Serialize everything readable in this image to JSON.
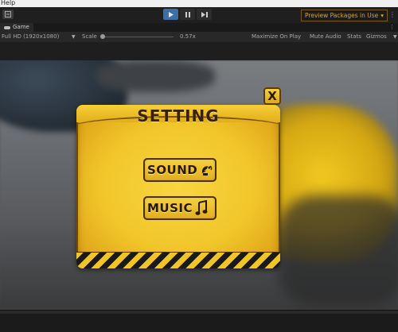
{
  "menubar": {
    "help_label": "Help"
  },
  "toolbar": {
    "preview_label": "Preview Packages in Use",
    "more_label": "⋮"
  },
  "tabs": {
    "game_label": "Game",
    "more_label": "⋮"
  },
  "controls": {
    "resolution": "Full HD (1920x1080)",
    "scale_label": "Scale",
    "scale_value": 0.57,
    "scale_text": "0.57x",
    "maximize_label": "Maximize On Play",
    "mute_label": "Mute Audio",
    "stats_label": "Stats",
    "gizmos_label": "Gizmos"
  },
  "dialog": {
    "title": "SETTING",
    "close_label": "X",
    "sound_label": "SOUND",
    "music_label": "MUSIC"
  },
  "colors": {
    "accent_blue": "#3b6fa6",
    "preview_orange": "#d9a63a",
    "dialog_yellow": "#f1c52a",
    "dialog_dark": "#2a1802"
  },
  "icons": {
    "play": "play-icon",
    "pause": "pause-icon",
    "step": "step-icon",
    "sound": "satellite-dish-icon",
    "music": "music-note-icon"
  }
}
